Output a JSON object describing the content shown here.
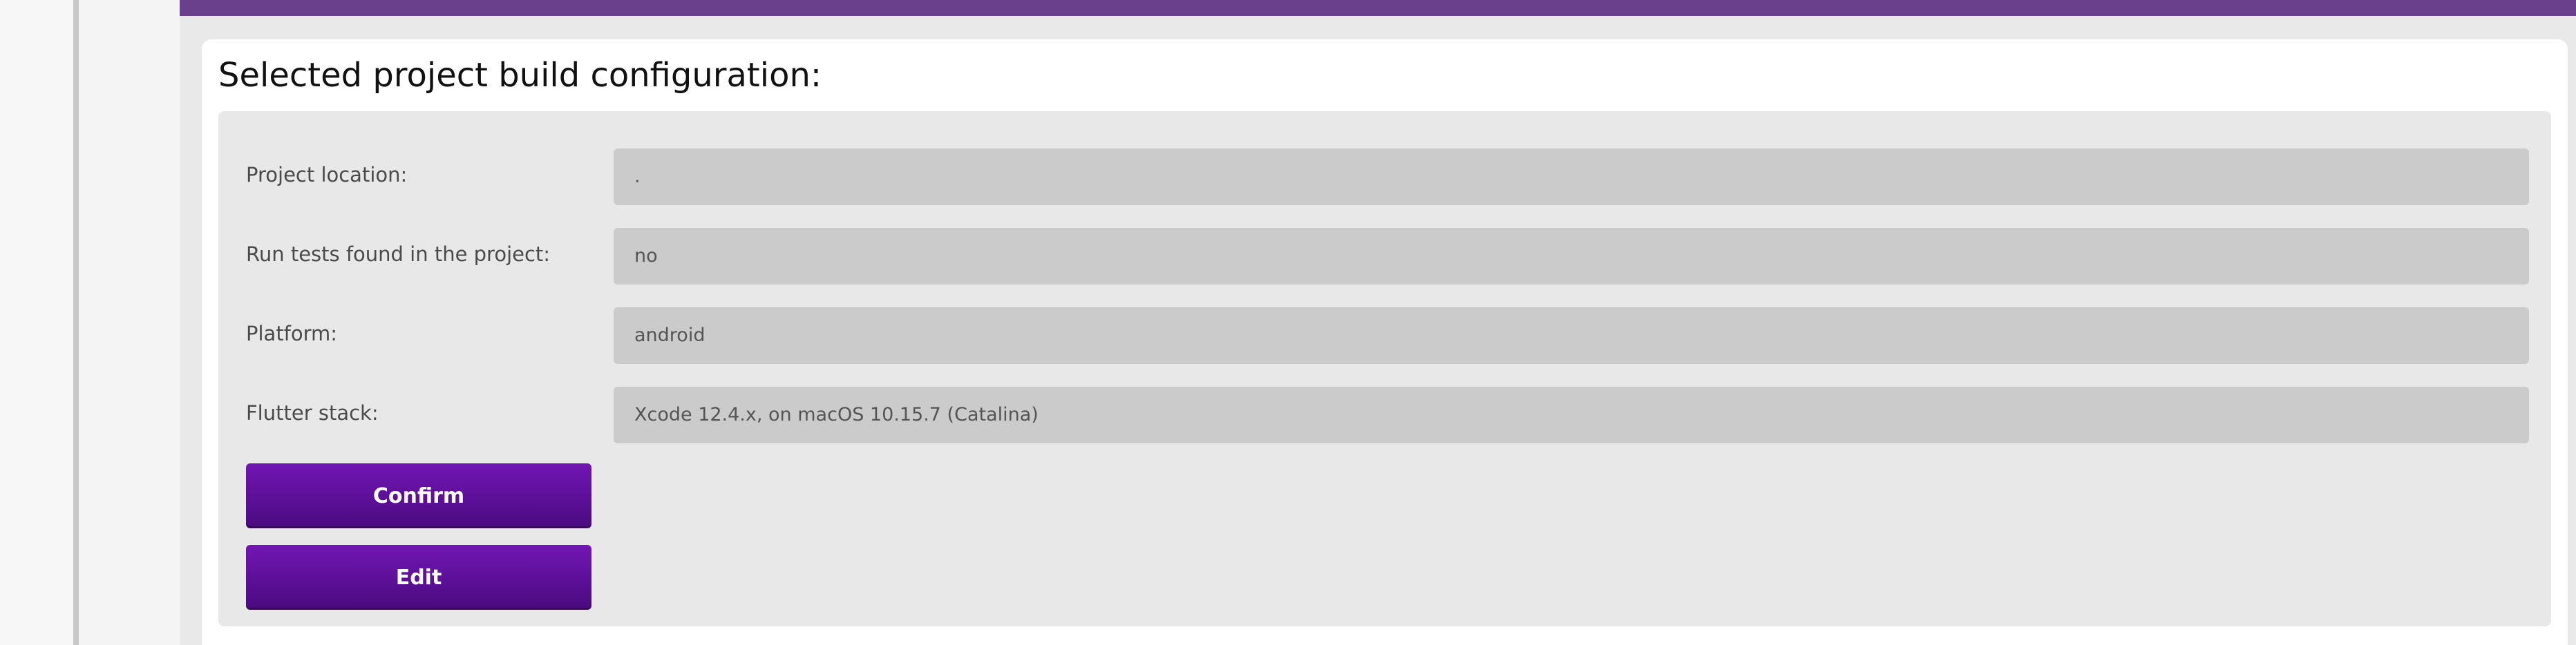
{
  "card": {
    "title": "Selected project build configuration:"
  },
  "config": {
    "rows": [
      {
        "label": "Project location:",
        "value": "."
      },
      {
        "label": "Run tests found in the project:",
        "value": "no"
      },
      {
        "label": "Platform:",
        "value": "android"
      },
      {
        "label": "Flutter stack:",
        "value": "Xcode 12.4.x, on macOS 10.15.7 (Catalina)"
      }
    ]
  },
  "actions": {
    "confirm_label": "Confirm",
    "edit_label": "Edit"
  },
  "colors": {
    "top_bar": "#6a3f8c",
    "button_accent": "#6a12a8",
    "panel": "#e8e8e8",
    "value_field": "#cbcbcb"
  }
}
